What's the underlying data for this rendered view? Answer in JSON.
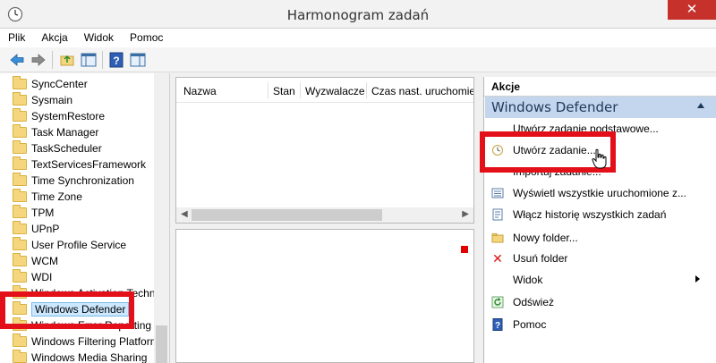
{
  "window": {
    "title": "Harmonogram zadań",
    "close_label": "✕"
  },
  "menu": [
    "Plik",
    "Akcja",
    "Widok",
    "Pomoc"
  ],
  "tree": {
    "items": [
      "SyncCenter",
      "Sysmain",
      "SystemRestore",
      "Task Manager",
      "TaskScheduler",
      "TextServicesFramework",
      "Time Synchronization",
      "Time Zone",
      "TPM",
      "UPnP",
      "User Profile Service",
      "WCM",
      "WDI",
      "Windows Activation Technologies",
      "Windows Defender",
      "Windows Error Reporting",
      "Windows Filtering Platform",
      "Windows Media Sharing"
    ],
    "selected": "Windows Defender"
  },
  "tasklist": {
    "columns": [
      "Nazwa",
      "Stan",
      "Wyzwalacze",
      "Czas nast. uruchomienia"
    ]
  },
  "actions": {
    "header": "Akcje",
    "group_title": "Windows Defender",
    "items": [
      {
        "label": "Utwórz zadanie podstawowe...",
        "icon": "basic-task-icon"
      },
      {
        "label": "Utwórz zadanie...",
        "icon": "create-task-icon"
      },
      {
        "label": "Importuj zadanie...",
        "icon": "import-task-icon"
      },
      {
        "label": "Wyświetl wszystkie uruchomione z...",
        "icon": "running-tasks-icon"
      },
      {
        "label": "Włącz historię wszystkich zadań",
        "icon": "history-icon"
      },
      {
        "label": "Nowy folder...",
        "icon": "new-folder-icon"
      },
      {
        "label": "Usuń folder",
        "icon": "delete-icon"
      },
      {
        "label": "Widok",
        "icon": ""
      },
      {
        "label": "Odśwież",
        "icon": "refresh-icon"
      },
      {
        "label": "Pomoc",
        "icon": "help-icon"
      }
    ]
  },
  "colors": {
    "highlight": "#e3101a",
    "group_bg": "#c4d6ee",
    "close_bg": "#c7312c"
  }
}
